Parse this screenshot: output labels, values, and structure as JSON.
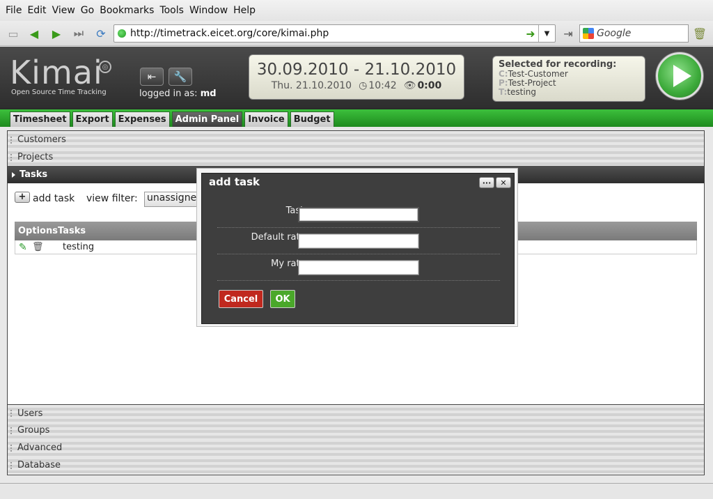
{
  "browser": {
    "menu": [
      "File",
      "Edit",
      "View",
      "Go",
      "Bookmarks",
      "Tools",
      "Window",
      "Help"
    ],
    "url": "http://timetrack.eicet.org/core/kimai.php",
    "search_placeholder": "Google"
  },
  "kimai": {
    "logo": "Kimai",
    "tagline": "Open Source Time Tracking",
    "logged_in_label": "logged in as:",
    "user": "md",
    "date_range": "30.09.2010 - 21.10.2010",
    "today": "Thu. 21.10.2010",
    "time": "10:42",
    "duration": "0:00",
    "recording": {
      "title": "Selected for recording:",
      "customer_prefix": "C:",
      "customer": "Test-Customer",
      "project_prefix": "P:",
      "project": "Test-Project",
      "task_prefix": "T:",
      "task": "testing"
    }
  },
  "tabs": [
    "Timesheet",
    "Export",
    "Expenses",
    "Admin Panel",
    "Invoice",
    "Budget"
  ],
  "active_tab": "Admin Panel",
  "sections_top": [
    "Customers",
    "Projects",
    "Tasks"
  ],
  "sections_bottom": [
    "Users",
    "Groups",
    "Advanced",
    "Database"
  ],
  "tasks_panel": {
    "add_label": "add task",
    "add_symbol": "+",
    "view_filter_label": "view filter:",
    "view_filter_value": "unassigned",
    "columns": [
      "Options",
      "Tasks"
    ],
    "rows": [
      {
        "name": "testing"
      }
    ]
  },
  "dialog": {
    "title": "add task",
    "fields": [
      {
        "label": "Task:",
        "value": ""
      },
      {
        "label": "Default rate:",
        "value": ""
      },
      {
        "label": "My rate:",
        "value": ""
      }
    ],
    "cancel": "Cancel",
    "ok": "OK",
    "cancel_color": "#c0281e",
    "ok_color": "#4aa82a"
  }
}
